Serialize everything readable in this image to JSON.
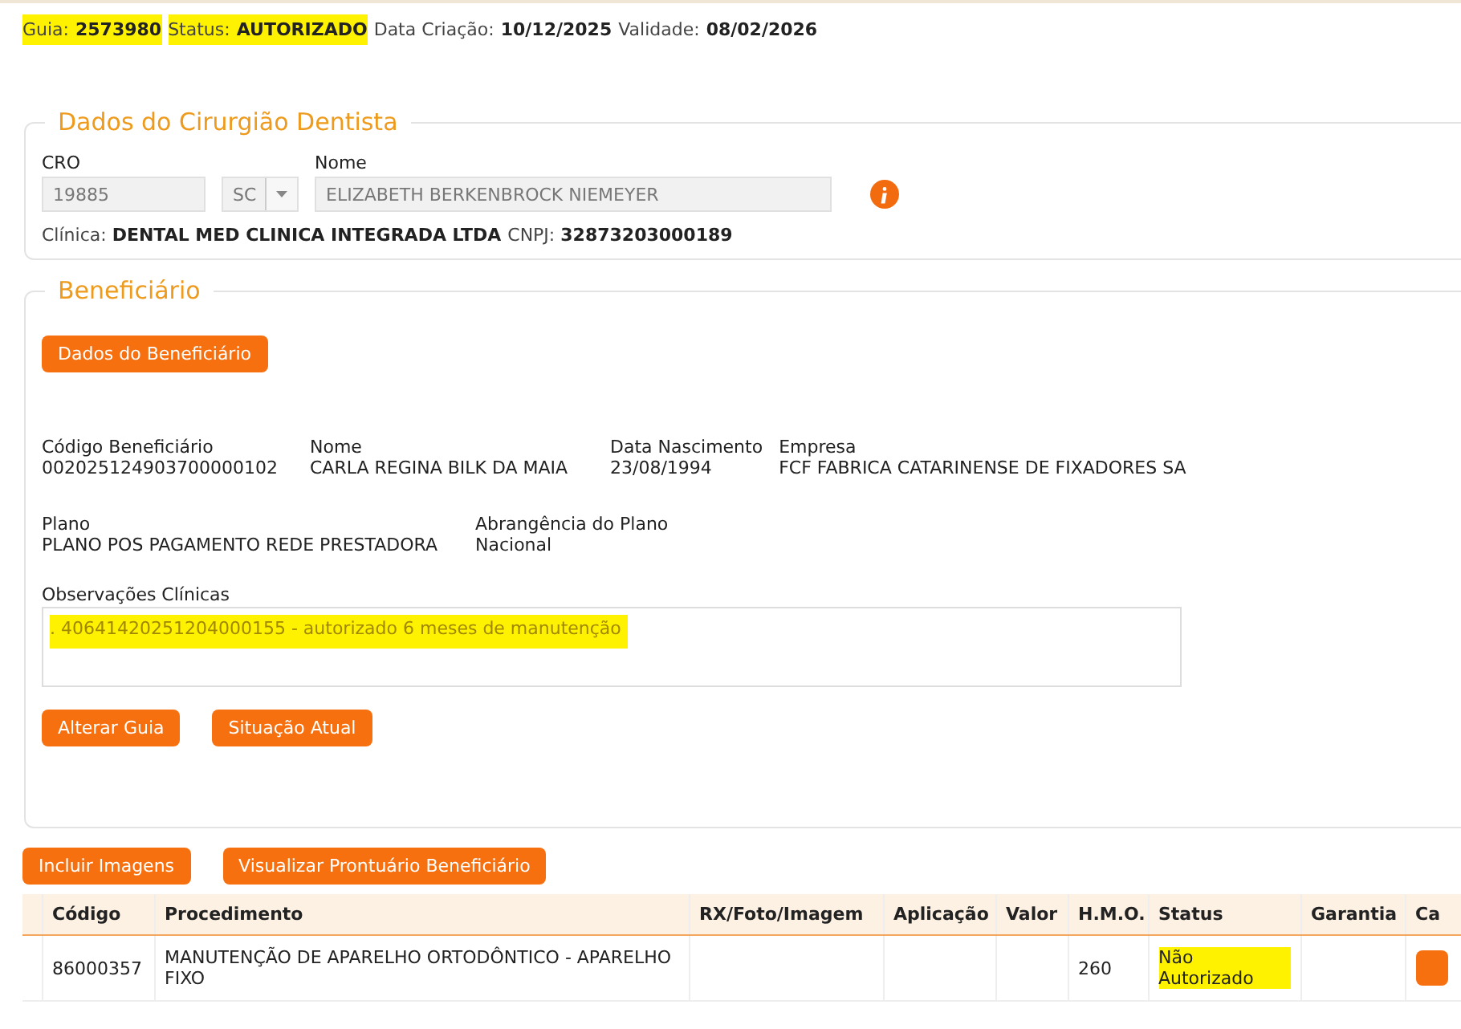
{
  "header": [
    {
      "label": "Guia:",
      "value": "2573980",
      "highlighted": true
    },
    {
      "label": "Status:",
      "value": "AUTORIZADO",
      "highlighted": true
    },
    {
      "label": "Data Criação:",
      "value": "10/12/2025",
      "highlighted": false
    },
    {
      "label": "Validade:",
      "value": "08/02/2026",
      "highlighted": false
    }
  ],
  "dentist": {
    "legend": "Dados do Cirurgião Dentista",
    "cro_label": "CRO",
    "cro": "19885",
    "uf": "SC",
    "name_label": "Nome",
    "name": "ELIZABETH BERKENBROCK NIEMEYER",
    "clinic": [
      {
        "label": "Clínica:",
        "value": "DENTAL MED CLINICA INTEGRADA LTDA"
      },
      {
        "label": "CNPJ:",
        "value": "32873203000189"
      }
    ]
  },
  "beneficiary": {
    "legend": "Beneficiário",
    "data_button": "Dados do Beneficiário",
    "row1": [
      {
        "label": "Código Beneficiário",
        "value": "002025124903700000102"
      },
      {
        "label": "Nome",
        "value": "CARLA REGINA BILK DA MAIA"
      },
      {
        "label": "Data Nascimento",
        "value": "23/08/1994"
      },
      {
        "label": "Empresa",
        "value": "FCF FABRICA CATARINENSE DE FIXADORES SA"
      }
    ],
    "row2": [
      {
        "label": "Plano",
        "value": "PLANO POS PAGAMENTO REDE PRESTADORA"
      },
      {
        "label": "Abrangência do Plano",
        "value": "Nacional"
      }
    ],
    "notes_label": "Observações Clínicas",
    "notes": ". 40641420251204000155 - autorizado 6 meses de manutenção",
    "notes_highlighted": true,
    "buttons": [
      "Alterar Guia",
      "Situação Atual"
    ]
  },
  "actions": [
    "Incluir Imagens",
    "Visualizar Prontuário Beneficiário"
  ],
  "table": {
    "columns": [
      "Código",
      "Procedimento",
      "RX/Foto/Imagem",
      "Aplicação",
      "Valor",
      "H.M.O.",
      "Status",
      "Garantia",
      "Ca"
    ],
    "rows": [
      {
        "cells": [
          "86000357",
          "MANUTENÇÃO DE APARELHO ORTODÔNTICO - APARELHO FIXO",
          "",
          "",
          "",
          "260",
          "Não Autorizado",
          "",
          ""
        ],
        "highlight_status": true
      }
    ]
  }
}
